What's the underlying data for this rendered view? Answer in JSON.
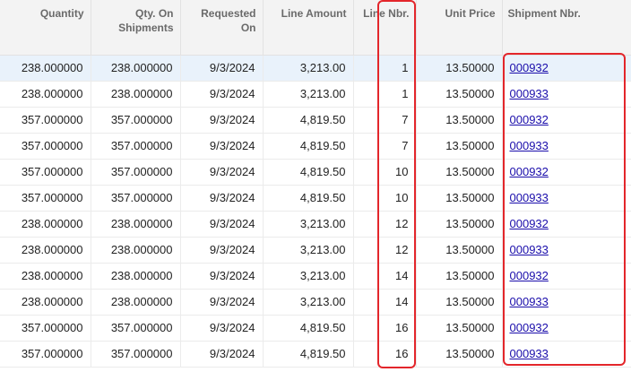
{
  "columns": [
    {
      "key": "quantity",
      "label": "Quantity"
    },
    {
      "key": "qty_on_shipments",
      "label": "Qty. On Shipments"
    },
    {
      "key": "requested_on",
      "label": "Requested On"
    },
    {
      "key": "line_amount",
      "label": "Line Amount"
    },
    {
      "key": "line_nbr",
      "label": "Line Nbr."
    },
    {
      "key": "unit_price",
      "label": "Unit Price"
    },
    {
      "key": "shipment_nbr",
      "label": "Shipment Nbr."
    }
  ],
  "rows": [
    {
      "quantity": "238.000000",
      "qty_on_shipments": "238.000000",
      "requested_on": "9/3/2024",
      "line_amount": "3,213.00",
      "line_nbr": "1",
      "unit_price": "13.50000",
      "shipment_nbr": "000932",
      "selected": true
    },
    {
      "quantity": "238.000000",
      "qty_on_shipments": "238.000000",
      "requested_on": "9/3/2024",
      "line_amount": "3,213.00",
      "line_nbr": "1",
      "unit_price": "13.50000",
      "shipment_nbr": "000933"
    },
    {
      "quantity": "357.000000",
      "qty_on_shipments": "357.000000",
      "requested_on": "9/3/2024",
      "line_amount": "4,819.50",
      "line_nbr": "7",
      "unit_price": "13.50000",
      "shipment_nbr": "000932"
    },
    {
      "quantity": "357.000000",
      "qty_on_shipments": "357.000000",
      "requested_on": "9/3/2024",
      "line_amount": "4,819.50",
      "line_nbr": "7",
      "unit_price": "13.50000",
      "shipment_nbr": "000933"
    },
    {
      "quantity": "357.000000",
      "qty_on_shipments": "357.000000",
      "requested_on": "9/3/2024",
      "line_amount": "4,819.50",
      "line_nbr": "10",
      "unit_price": "13.50000",
      "shipment_nbr": "000932"
    },
    {
      "quantity": "357.000000",
      "qty_on_shipments": "357.000000",
      "requested_on": "9/3/2024",
      "line_amount": "4,819.50",
      "line_nbr": "10",
      "unit_price": "13.50000",
      "shipment_nbr": "000933"
    },
    {
      "quantity": "238.000000",
      "qty_on_shipments": "238.000000",
      "requested_on": "9/3/2024",
      "line_amount": "3,213.00",
      "line_nbr": "12",
      "unit_price": "13.50000",
      "shipment_nbr": "000932"
    },
    {
      "quantity": "238.000000",
      "qty_on_shipments": "238.000000",
      "requested_on": "9/3/2024",
      "line_amount": "3,213.00",
      "line_nbr": "12",
      "unit_price": "13.50000",
      "shipment_nbr": "000933"
    },
    {
      "quantity": "238.000000",
      "qty_on_shipments": "238.000000",
      "requested_on": "9/3/2024",
      "line_amount": "3,213.00",
      "line_nbr": "14",
      "unit_price": "13.50000",
      "shipment_nbr": "000932"
    },
    {
      "quantity": "238.000000",
      "qty_on_shipments": "238.000000",
      "requested_on": "9/3/2024",
      "line_amount": "3,213.00",
      "line_nbr": "14",
      "unit_price": "13.50000",
      "shipment_nbr": "000933"
    },
    {
      "quantity": "357.000000",
      "qty_on_shipments": "357.000000",
      "requested_on": "9/3/2024",
      "line_amount": "4,819.50",
      "line_nbr": "16",
      "unit_price": "13.50000",
      "shipment_nbr": "000932"
    },
    {
      "quantity": "357.000000",
      "qty_on_shipments": "357.000000",
      "requested_on": "9/3/2024",
      "line_amount": "4,819.50",
      "line_nbr": "16",
      "unit_price": "13.50000",
      "shipment_nbr": "000933"
    }
  ],
  "colors": {
    "highlight": "#e3262b",
    "link": "#1a0dab",
    "selected_row": "#e9f2fb",
    "header_bg": "#f3f3f3"
  }
}
